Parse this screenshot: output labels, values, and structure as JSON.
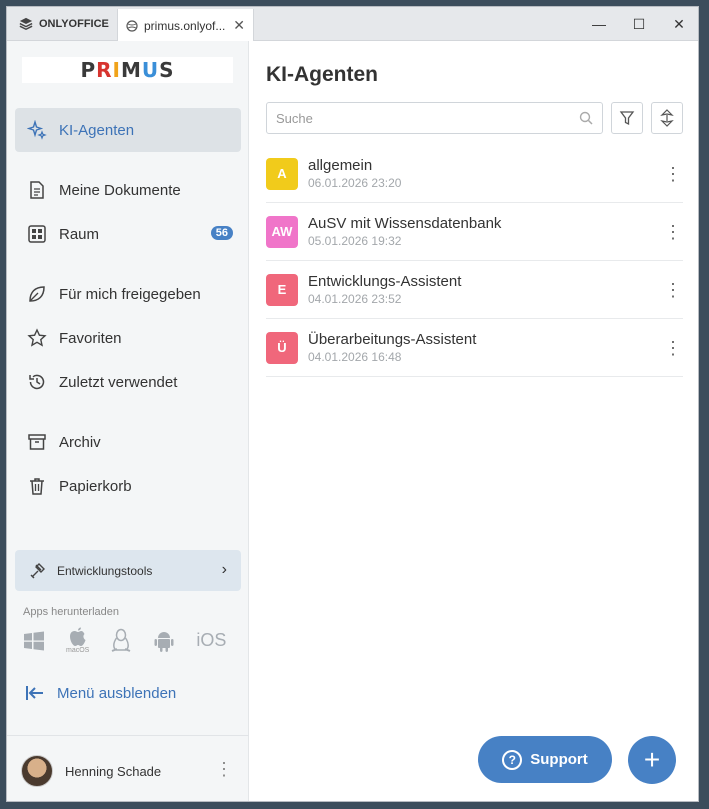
{
  "titlebar": {
    "app_name": "ONLYOFFICE",
    "tab_title": "primus.onlyof...",
    "close": "✕",
    "minimize": "—",
    "maximize": "☐",
    "window_close": "✕"
  },
  "sidebar": {
    "logo_text": [
      "P",
      "R",
      "I",
      "M",
      "U",
      "S"
    ],
    "logo_colors": [
      "#3a3a3a",
      "#d7342f",
      "#f0a31a",
      "#3a3a3a",
      "#3a8fd8",
      "#3a3a3a"
    ],
    "items": [
      {
        "label": "KI-Agenten",
        "icon": "sparkle-icon",
        "active": true
      },
      {
        "label": "Meine Dokumente",
        "icon": "document-icon"
      },
      {
        "label": "Raum",
        "icon": "grid-icon",
        "badge": "56"
      },
      {
        "label": "Für mich freigegeben",
        "icon": "shared-leaf-icon"
      },
      {
        "label": "Favoriten",
        "icon": "star-icon"
      },
      {
        "label": "Zuletzt verwendet",
        "icon": "history-icon"
      },
      {
        "label": "Archiv",
        "icon": "archive-icon"
      },
      {
        "label": "Papierkorb",
        "icon": "trash-icon"
      }
    ],
    "devtools_label": "Entwicklungstools",
    "apps_label": "Apps herunterladen",
    "apps": [
      "windows-icon",
      "apple-icon",
      "linux-icon",
      "android-icon",
      "ios-icon"
    ],
    "macos_label": "macOS",
    "ios_label": "iOS",
    "hide_menu_label": "Menü ausblenden",
    "user_name": "Henning Schade"
  },
  "main": {
    "title": "KI-Agenten",
    "search_placeholder": "Suche",
    "agents": [
      {
        "initials": "A",
        "color": "#f1cb1b",
        "name": "allgemein",
        "date": "06.01.2026 23:20"
      },
      {
        "initials": "AW",
        "color": "#f075c9",
        "name": "AuSV mit Wissensdatenbank",
        "date": "05.01.2026 19:32"
      },
      {
        "initials": "E",
        "color": "#f0677b",
        "name": "Entwicklungs-Assistent",
        "date": "04.01.2026 23:52"
      },
      {
        "initials": "Ü",
        "color": "#f0677b",
        "name": "Überarbeitungs-Assistent",
        "date": "04.01.2026 16:48"
      }
    ],
    "support_label": "Support",
    "fab_label": "+"
  },
  "colors": {
    "accent": "#4781c5",
    "active_bg": "#dde2e6"
  }
}
